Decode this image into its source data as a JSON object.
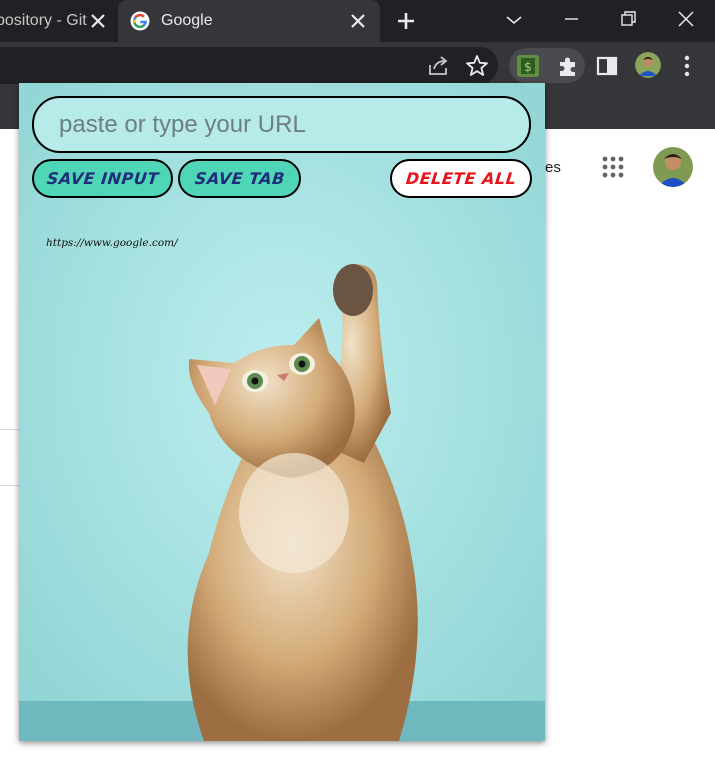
{
  "browser": {
    "tabs": [
      {
        "title": "pository - Git",
        "active": false
      },
      {
        "title": "Google",
        "active": true
      }
    ],
    "icons": {
      "tab_close": "close-icon",
      "new_tab": "plus-icon",
      "tab_search": "chevron-down-icon",
      "minimize": "minimize-icon",
      "restore": "restore-icon",
      "close_window": "close-icon",
      "share": "share-icon",
      "bookmark": "star-icon",
      "extension_active": "dollar-extension-icon",
      "extensions": "puzzle-icon",
      "side_panel": "side-panel-icon",
      "menu": "kebab-menu-icon"
    }
  },
  "page": {
    "header_link_partial": "es",
    "apps_icon": "apps-grid-icon"
  },
  "popup": {
    "url_input": {
      "value": "",
      "placeholder": "paste or type your URL"
    },
    "buttons": {
      "save_input": "SAVE INPUT",
      "save_tab": "SAVE TAB",
      "delete_all": "DELETE ALL"
    },
    "saved_links": [
      "https://www.google.com/"
    ],
    "colors": {
      "background": "#b7ebea",
      "save_button": "#4fd6b6",
      "save_text": "#1f2d7a",
      "delete_text": "#e8141b"
    }
  }
}
